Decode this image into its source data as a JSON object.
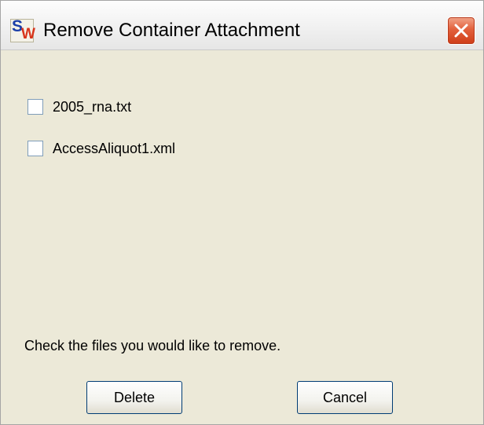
{
  "window": {
    "title": "Remove Container Attachment",
    "app_icon": {
      "letter_top": "S",
      "letter_bottom": "W",
      "name": "sw-app-icon"
    }
  },
  "files": [
    {
      "name": "2005_rna.txt",
      "checked": false
    },
    {
      "name": "AccessAliquot1.xml",
      "checked": false
    }
  ],
  "hint_text": "Check the files you would like to remove.",
  "buttons": {
    "delete_label": "Delete",
    "cancel_label": "Cancel"
  },
  "colors": {
    "dialog_bg": "#ece9d8",
    "close_button": "#e2603c",
    "checkbox_border": "#7f9db9",
    "button_border": "#003c74"
  }
}
